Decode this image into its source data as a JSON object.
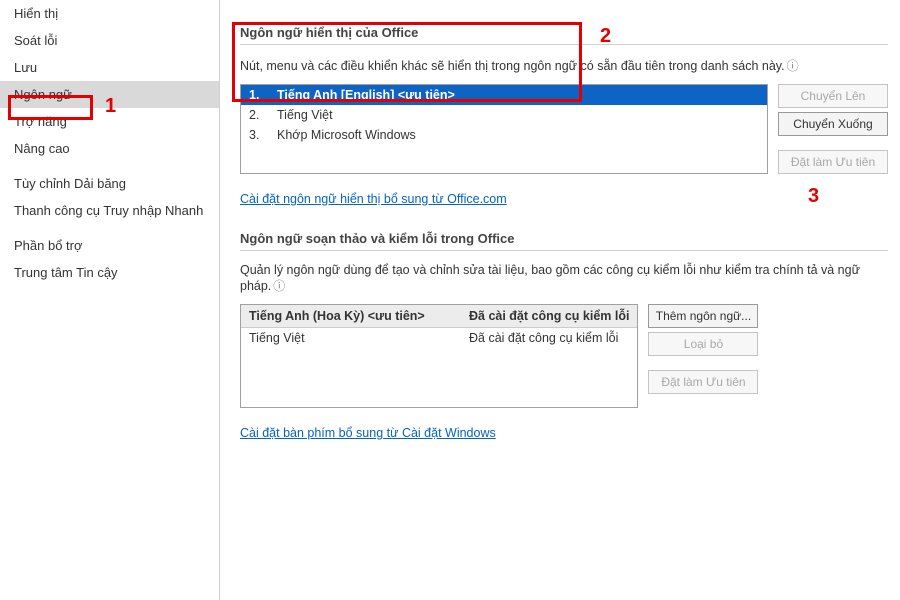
{
  "sidebar": {
    "items": [
      {
        "label": "Hiển thị"
      },
      {
        "label": "Soát lỗi"
      },
      {
        "label": "Lưu"
      },
      {
        "label": "Ngôn ngữ"
      },
      {
        "label": "Trợ năng"
      },
      {
        "label": "Nâng cao"
      },
      {
        "label": "Tùy chỉnh Dải băng"
      },
      {
        "label": "Thanh công cụ Truy nhập Nhanh"
      },
      {
        "label": "Phần bổ trợ"
      },
      {
        "label": "Trung tâm Tin cậy"
      }
    ],
    "selected_index": 3
  },
  "display_section": {
    "title": "Ngôn ngữ hiển thị của Office",
    "desc": "Nút, menu và các điều khiển khác sẽ hiển thị trong ngôn ngữ có sẵn đầu tiên trong danh sách này.",
    "list": [
      {
        "idx": "1.",
        "label": "Tiếng Anh [English] <ưu tiên>"
      },
      {
        "idx": "2.",
        "label": "Tiếng Việt"
      },
      {
        "idx": "3.",
        "label": "Khớp Microsoft Windows"
      }
    ],
    "selected_index": 0,
    "buttons": {
      "move_up": "Chuyển Lên",
      "move_down": "Chuyển Xuống",
      "set_preferred": "Đặt làm Ưu tiên"
    },
    "link": "Cài đặt ngôn ngữ hiển thị bổ sung từ Office.com"
  },
  "editing_section": {
    "title": "Ngôn ngữ soạn thảo và kiểm lỗi trong Office",
    "desc": "Quản lý ngôn ngữ dùng để tạo và chỉnh sửa tài liệu, bao gồm các công cụ kiểm lỗi như kiểm tra chính tả và ngữ pháp.",
    "headers": {
      "col1": "Tiếng Anh (Hoa Kỳ) <ưu tiên>",
      "col2": "Đã cài đặt công cụ kiểm lỗi"
    },
    "rows": [
      {
        "lang": "Tiếng Việt",
        "status": "Đã cài đặt công cụ kiểm lỗi"
      }
    ],
    "buttons": {
      "add": "Thêm ngôn ngữ...",
      "remove": "Loại bỏ",
      "set_preferred": "Đặt làm Ưu tiên"
    },
    "link": "Cài đặt bàn phím bổ sung từ Cài đặt Windows"
  },
  "annotations": {
    "l1": "1",
    "l2": "2",
    "l3": "3"
  }
}
